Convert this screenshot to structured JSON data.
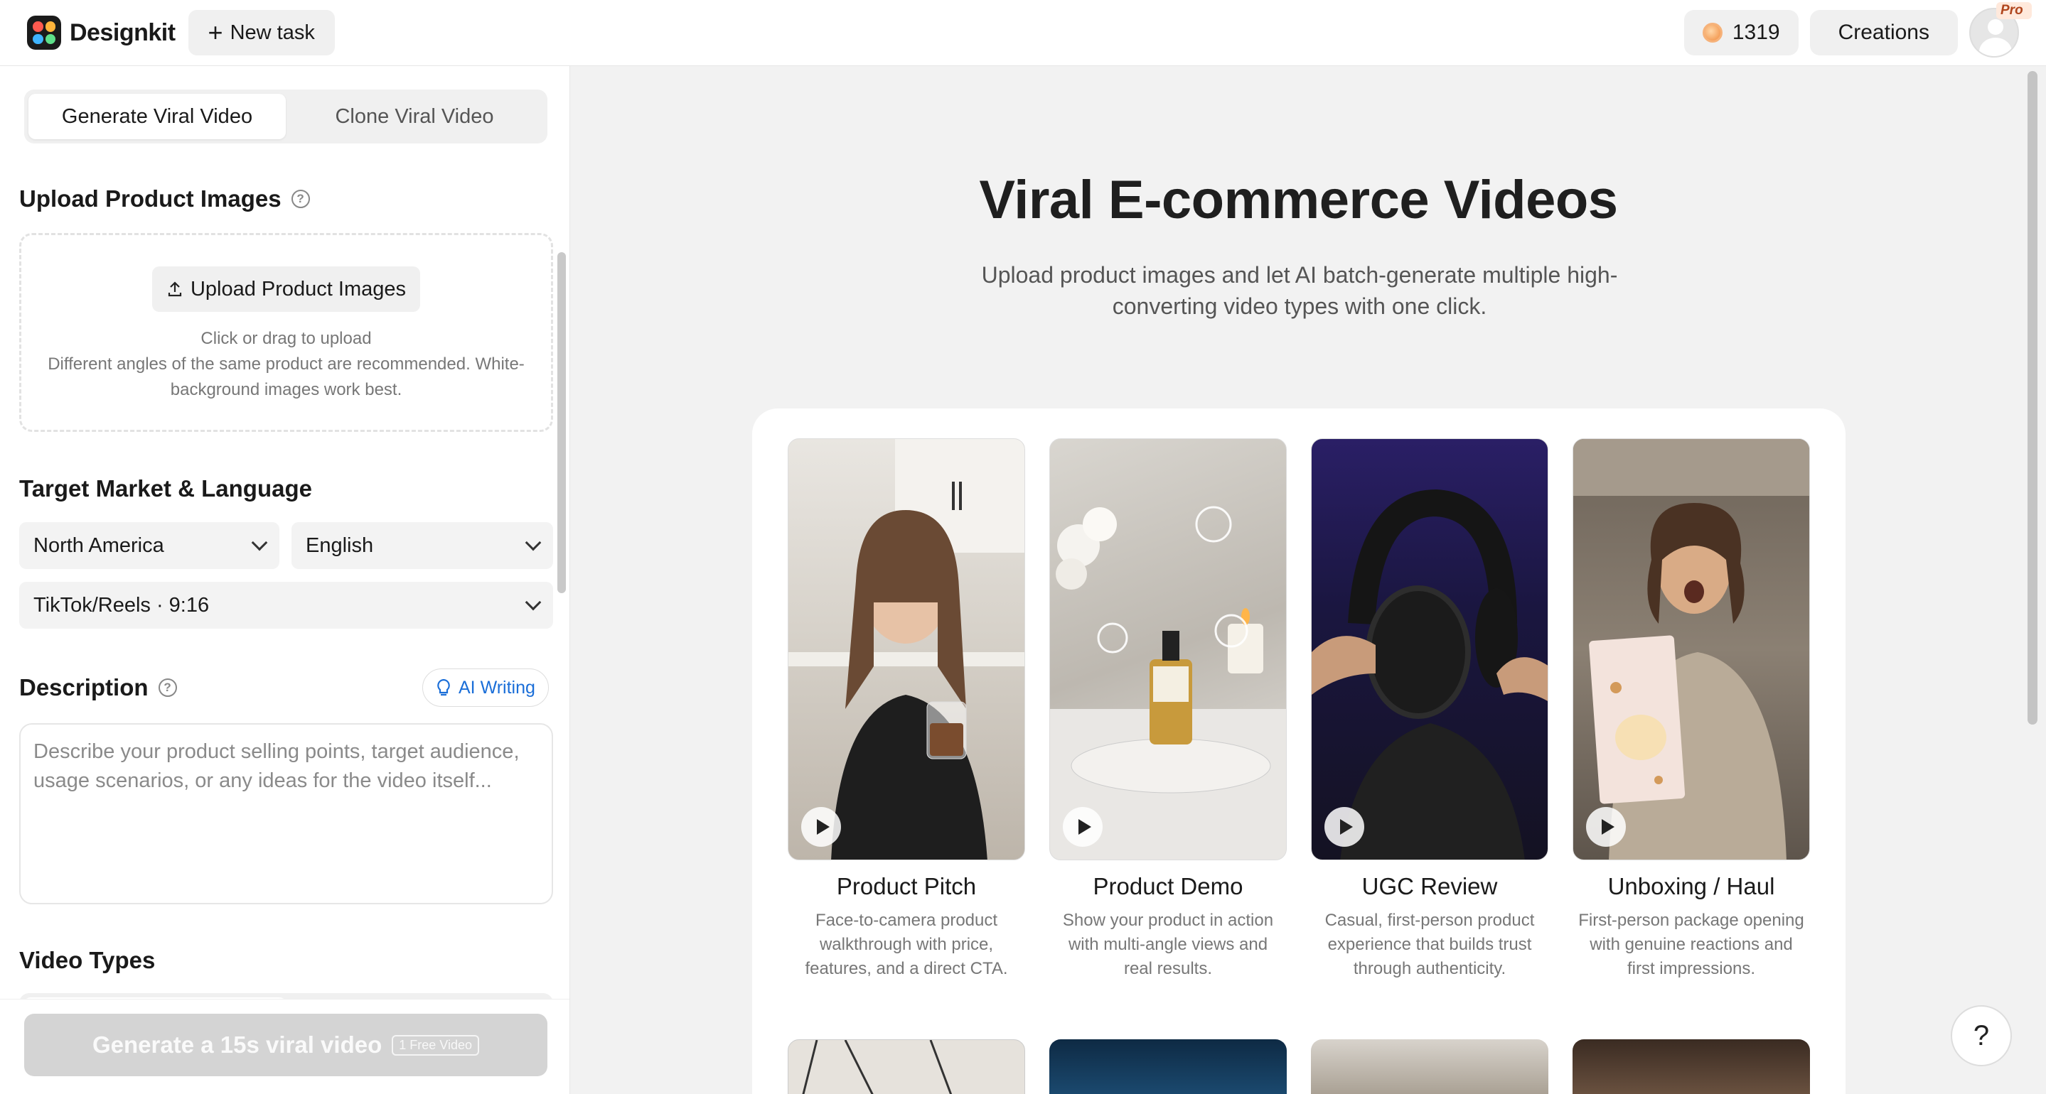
{
  "app": {
    "name": "Designkit",
    "new_task": "New task"
  },
  "topbar": {
    "credits": "1319",
    "creations": "Creations",
    "badge": "Pro"
  },
  "left": {
    "tabs": [
      "Generate Viral Video",
      "Clone Viral Video"
    ],
    "upload": {
      "title": "Upload Product Images",
      "button": "Upload Product Images",
      "hint1": "Click or drag to upload",
      "hint2": "Different angles of the same product are recommended. White-background images work best."
    },
    "market": {
      "title": "Target Market & Language",
      "region": "North America",
      "language": "English",
      "format": "TikTok/Reels · 9:16"
    },
    "description": {
      "title": "Description",
      "ai_writing": "AI Writing",
      "placeholder": "Describe your product selling points, target audience, usage scenarios, or any ideas for the video itself..."
    },
    "video_types": {
      "title": "Video Types"
    },
    "generate": {
      "label": "Generate a 15s viral video",
      "tag": "1 Free Video"
    }
  },
  "main": {
    "title": "Viral E-commerce Videos",
    "subtitle": "Upload product images and let AI batch-generate multiple high-converting video types with one click.",
    "cards": [
      {
        "title": "Product Pitch",
        "desc": "Face-to-camera product walkthrough with price, features, and a direct CTA."
      },
      {
        "title": "Product Demo",
        "desc": "Show your product in action with multi-angle views and real results."
      },
      {
        "title": "UGC Review",
        "desc": "Casual, first-person product experience that builds trust through authenticity."
      },
      {
        "title": "Unboxing / Haul",
        "desc": "First-person package opening with genuine reactions and first impressions."
      }
    ],
    "help": "?"
  },
  "colors": {
    "accent_link": "#1a6ed8",
    "disabled_button": "#d4d4d4"
  }
}
